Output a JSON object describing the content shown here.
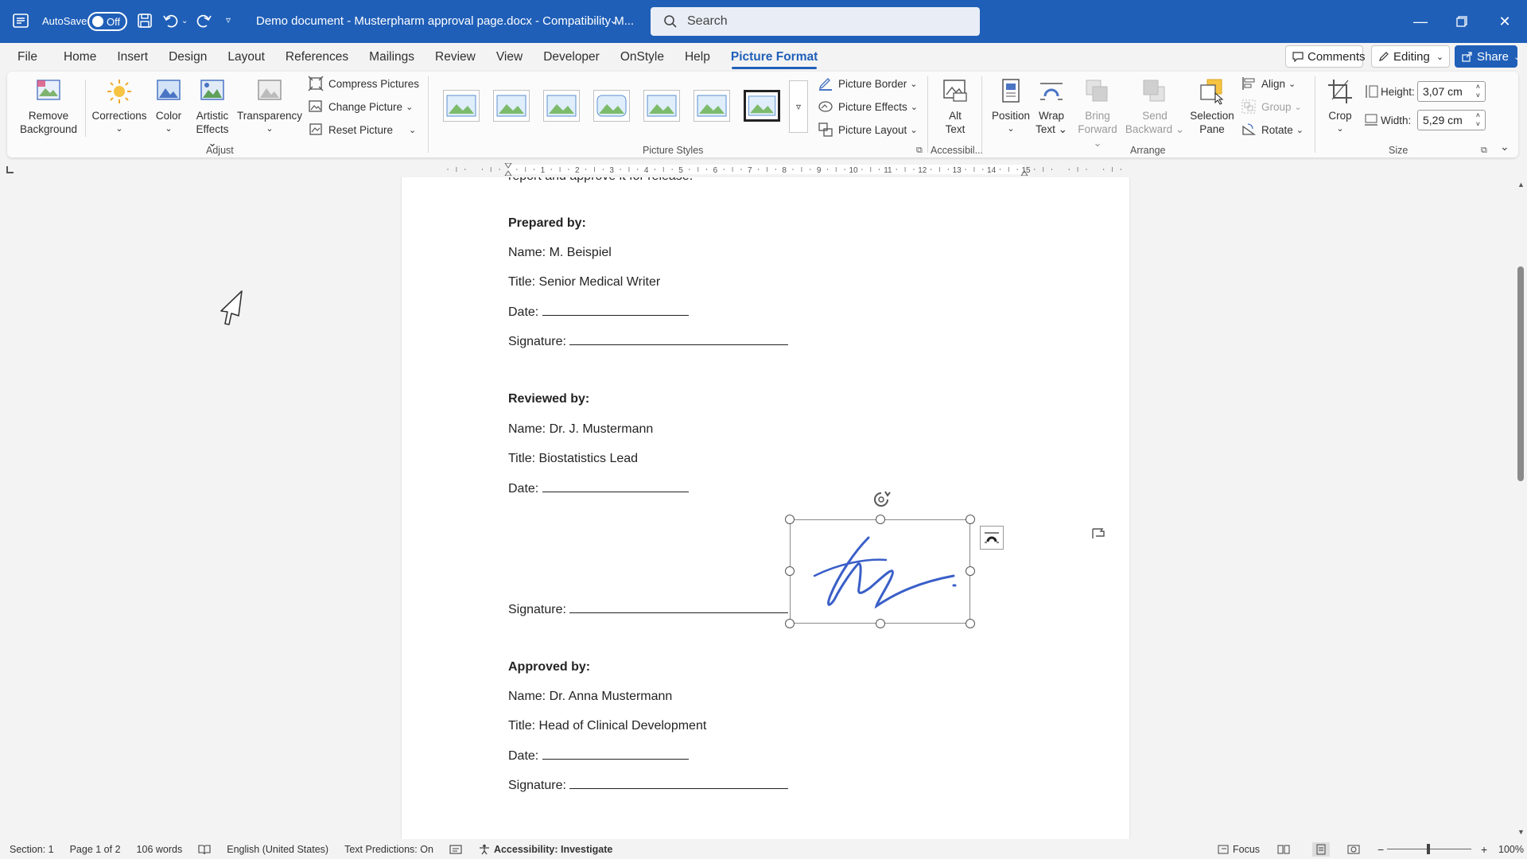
{
  "titlebar": {
    "autosave_label": "AutoSave",
    "autosave_state": "Off",
    "doc_title": "Demo document - Musterpharm approval page.docx - Compatibility M...",
    "search_placeholder": "Search"
  },
  "menu": {
    "tabs": [
      "File",
      "Home",
      "Insert",
      "Design",
      "Layout",
      "References",
      "Mailings",
      "Review",
      "View",
      "Developer",
      "OnStyle",
      "Help",
      "Picture Format"
    ],
    "active": "Picture Format",
    "comments": "Comments",
    "editing": "Editing",
    "share": "Share"
  },
  "ribbon": {
    "remove_background": [
      "Remove",
      "Background"
    ],
    "corrections": "Corrections",
    "color": "Color",
    "artistic_effects": [
      "Artistic",
      "Effects"
    ],
    "transparency": "Transparency",
    "compress": "Compress Pictures",
    "change_picture": "Change Picture",
    "reset_picture": "Reset Picture",
    "adjust_label": "Adjust",
    "picture_styles_label": "Picture Styles",
    "picture_border": "Picture Border",
    "picture_effects": "Picture Effects",
    "picture_layout": "Picture Layout",
    "alt_text": [
      "Alt",
      "Text"
    ],
    "accessibility_label": "Accessibil...",
    "position": "Position",
    "wrap_text": [
      "Wrap",
      "Text"
    ],
    "bring_forward": [
      "Bring",
      "Forward"
    ],
    "send_backward": [
      "Send",
      "Backward"
    ],
    "selection_pane": [
      "Selection",
      "Pane"
    ],
    "align": "Align",
    "group": "Group",
    "rotate": "Rotate",
    "arrange_label": "Arrange",
    "crop": "Crop",
    "height_label": "Height:",
    "height_value": "3,07 cm",
    "width_label": "Width:",
    "width_value": "5,29 cm",
    "size_label": "Size"
  },
  "ruler_numbers": [
    "1",
    "2",
    "3",
    "4",
    "5",
    "6",
    "7",
    "8",
    "9",
    "10",
    "11",
    "12",
    "13",
    "14",
    "15"
  ],
  "document": {
    "top_line": "report and approve it for release.",
    "prepared_heading": "Prepared by:",
    "prepared_name": "Name: M. Beispiel",
    "prepared_title": "Title: Senior Medical Writer",
    "date_label": "Date: ",
    "signature_label": "Signature: ",
    "reviewed_heading": "Reviewed by:",
    "reviewed_name": "Name: Dr. J. Mustermann",
    "reviewed_title": "Title: Biostatistics Lead",
    "approved_heading": "Approved by:",
    "approved_name": "Name: Dr. Anna Mustermann",
    "approved_title": "Title: Head of Clinical Development"
  },
  "status": {
    "section": "Section: 1",
    "page": "Page 1 of 2",
    "words": "106 words",
    "language": "English (United States)",
    "predictions": "Text Predictions: On",
    "accessibility": "Accessibility: Investigate",
    "focus": "Focus",
    "zoom": "100%"
  },
  "colors": {
    "accent": "#1f5fb8",
    "signature_ink": "#3a5fc8"
  }
}
